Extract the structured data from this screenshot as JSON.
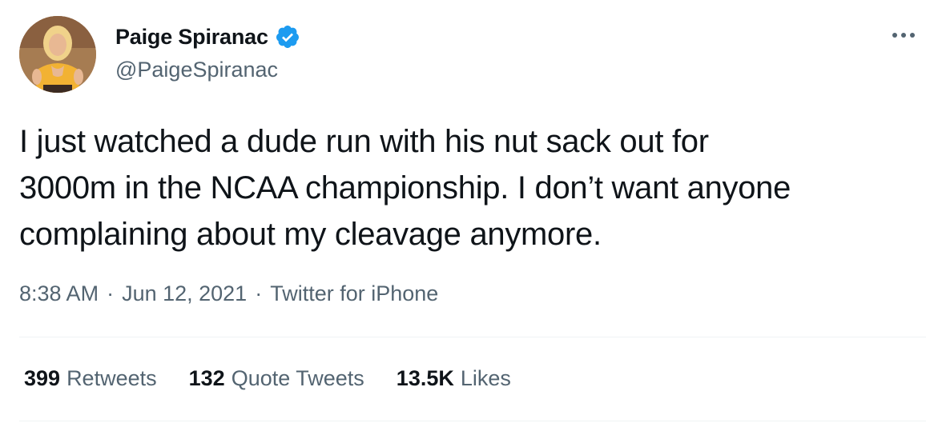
{
  "author": {
    "display_name": "Paige Spiranac",
    "handle": "@PaigeSpiranac",
    "verified": true
  },
  "tweet": {
    "text": "I just watched a dude run with his nut sack out for\n3000m in the NCAA championship. I don’t want anyone\ncomplaining about my cleavage anymore."
  },
  "meta": {
    "time": "8:38 AM",
    "separator": "·",
    "date": "Jun 12, 2021",
    "source": "Twitter for iPhone"
  },
  "stats": [
    {
      "value": "399",
      "label": "Retweets"
    },
    {
      "value": "132",
      "label": "Quote Tweets"
    },
    {
      "value": "13.5K",
      "label": "Likes"
    }
  ],
  "colors": {
    "verified_blue": "#1d9bf0",
    "secondary_text": "#536471",
    "primary_text": "#0f1419",
    "divider": "#eff3f4"
  },
  "icons": {
    "verified": "verified-badge-icon",
    "more": "more-options-icon"
  }
}
